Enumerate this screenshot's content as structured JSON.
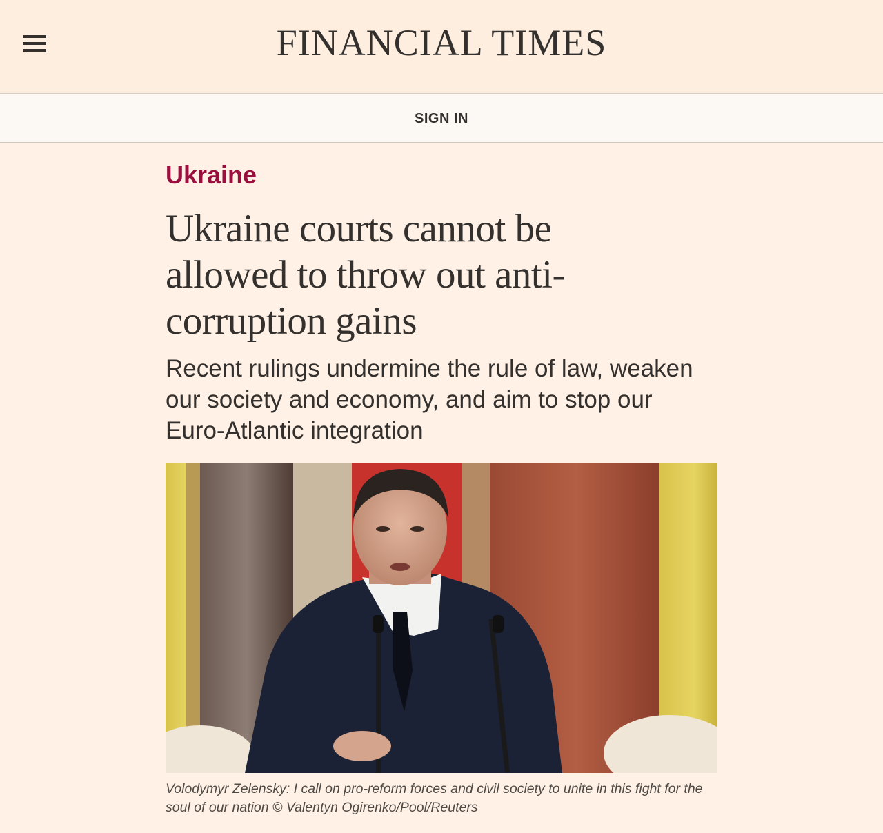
{
  "header": {
    "menu_icon": "hamburger-menu-icon",
    "masthead": "FINANCIAL TIMES"
  },
  "signin": {
    "label": "SIGN IN"
  },
  "article": {
    "topic": "Ukraine",
    "headline": "Ukraine courts cannot be allowed to throw out anti-corruption gains",
    "standfirst": "Recent rulings undermine the rule of law, weaken our society and economy, and aim to stop our Euro-Atlantic integration",
    "image_caption": "Volodymyr Zelensky: I call on pro-reform forces and civil society to unite in this fight for the soul of our nation © Valentyn Ogirenko/Pool/Reuters"
  },
  "colors": {
    "page_background": "#fff1e5",
    "topic_color": "#990f3d",
    "text_color": "#33302e"
  }
}
